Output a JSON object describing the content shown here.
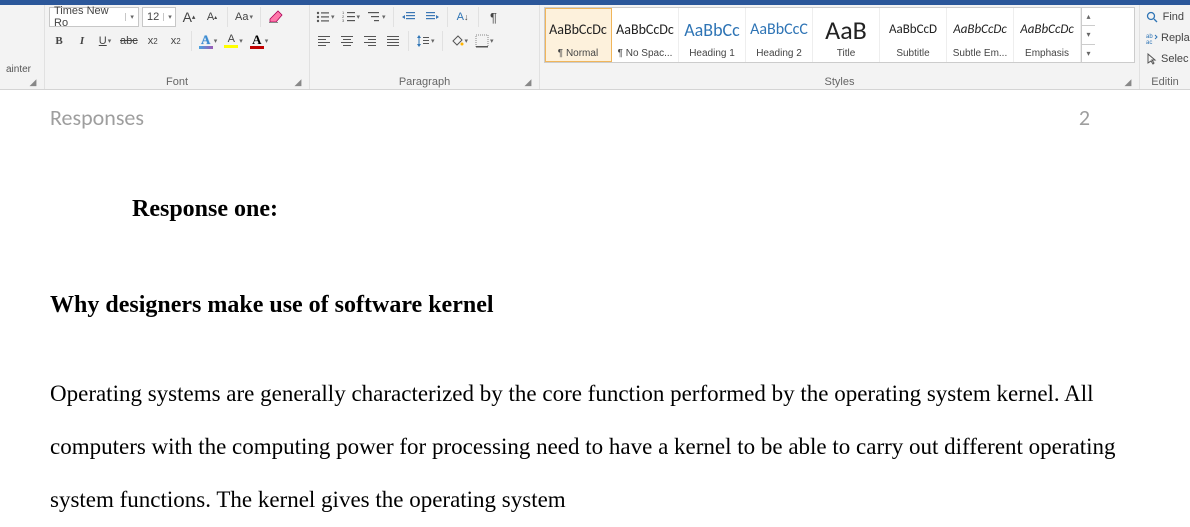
{
  "ribbon": {
    "painter_label": "ainter",
    "font": {
      "group_label": "Font",
      "name": "Times New Ro",
      "size": "12",
      "grow": "A",
      "shrink": "A",
      "change_case": "Aa",
      "bold": "B",
      "italic": "I",
      "underline": "U",
      "strike": "abc",
      "sub_base": "x",
      "sub_idx": "2",
      "sup_base": "x",
      "sup_idx": "2",
      "textfx_A": "A",
      "highlight_A": "A",
      "fontcolor_A": "A"
    },
    "paragraph": {
      "group_label": "Paragraph",
      "sort_label": "A↓",
      "show_marks": "¶",
      "line_spacing": "↕≡"
    },
    "styles": {
      "group_label": "Styles",
      "items": [
        {
          "preview": "AaBbCcDc",
          "name": "¶ Normal",
          "size": "14px",
          "blue": false,
          "italic": false,
          "selected": true
        },
        {
          "preview": "AaBbCcDc",
          "name": "¶ No Spac...",
          "size": "14px",
          "blue": false,
          "italic": false,
          "selected": false
        },
        {
          "preview": "AaBbCc",
          "name": "Heading 1",
          "size": "18px",
          "blue": true,
          "italic": false,
          "selected": false
        },
        {
          "preview": "AaBbCcC",
          "name": "Heading 2",
          "size": "16px",
          "blue": true,
          "italic": false,
          "selected": false
        },
        {
          "preview": "AaB",
          "name": "Title",
          "size": "26px",
          "blue": false,
          "italic": false,
          "selected": false
        },
        {
          "preview": "AaBbCcD",
          "name": "Subtitle",
          "size": "13px",
          "blue": false,
          "italic": false,
          "selected": false
        },
        {
          "preview": "AaBbCcDc",
          "name": "Subtle Em...",
          "size": "13px",
          "blue": false,
          "italic": true,
          "selected": false
        },
        {
          "preview": "AaBbCcDc",
          "name": "Emphasis",
          "size": "13px",
          "blue": false,
          "italic": true,
          "selected": false
        }
      ]
    },
    "editing": {
      "group_label": "Editin",
      "find": "Find",
      "replace": "Repla",
      "select": "Selec"
    }
  },
  "document": {
    "header_left": "Responses",
    "header_right": "2",
    "response_one": "Response one:",
    "subheading": "Why designers make use of software kernel",
    "paragraph": "Operating systems are generally characterized by the core function performed by the operating system kernel. All computers with the computing power for processing need to have a kernel to be able to carry out different operating system functions. The kernel gives the operating system"
  }
}
